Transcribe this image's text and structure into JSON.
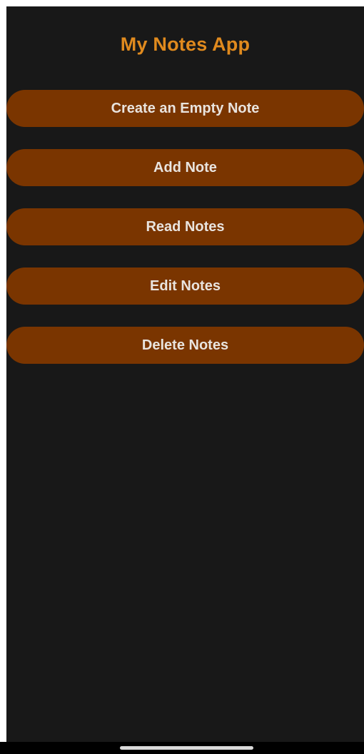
{
  "app": {
    "title": "My Notes App"
  },
  "menu": {
    "buttons": [
      {
        "id": "create-empty-note",
        "label": "Create an Empty Note"
      },
      {
        "id": "add-note",
        "label": "Add Note"
      },
      {
        "id": "read-notes",
        "label": "Read Notes"
      },
      {
        "id": "edit-notes",
        "label": "Edit Notes"
      },
      {
        "id": "delete-notes",
        "label": "Delete Notes"
      }
    ]
  },
  "colors": {
    "background": "#181818",
    "title": "#e08a1e",
    "button_bg": "#7a3500",
    "button_text": "#e9e4df",
    "nav_bar": "#000000",
    "home_indicator": "#d9d9d9"
  }
}
